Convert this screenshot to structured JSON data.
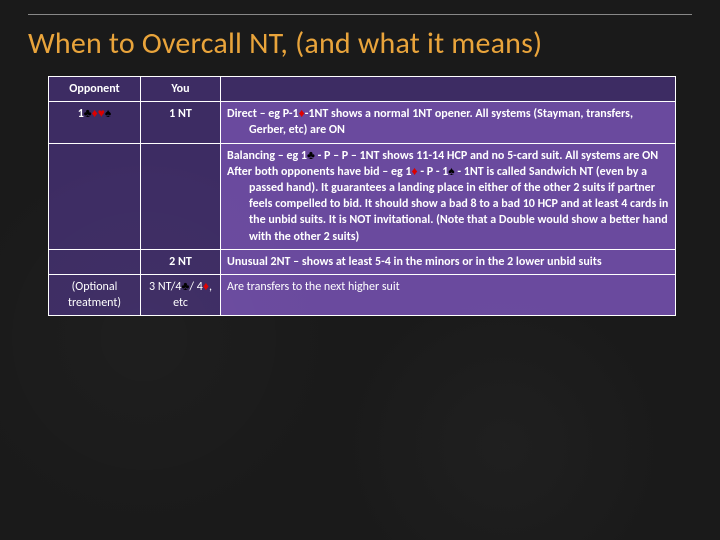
{
  "title": "When to Overcall NT, (and what it means)",
  "suits": {
    "club": "♣",
    "diamond": "♦",
    "heart": "♥",
    "spade": "♠"
  },
  "headers": {
    "opponent": "Opponent",
    "you": "You"
  },
  "rows": [
    {
      "opponent_prefix": "1",
      "opponent_suits": [
        "club",
        "diamond",
        "heart",
        "spade"
      ],
      "you": "1 NT",
      "desc_lead": "Direct – eg P-1",
      "desc_mid_suit": "diamond",
      "desc_tail": "-1NT shows a normal 1NT opener. All systems (Stayman, transfers, Gerber, etc) are ON"
    },
    {
      "opponent_prefix": "",
      "you": "",
      "para1_lead": "Balancing – eg 1",
      "para1_suit": "club",
      "para1_tail": " - P – P – 1NT shows 11-14 HCP and no 5-card suit. All systems are ON",
      "para2_lead": "After both opponents have bid – eg  1",
      "para2_suit1": "diamond",
      "para2_mid": " - P - 1",
      "para2_suit2": "spade",
      "para2_tail": " - 1NT is called Sandwich NT (even by a passed hand). It guarantees a landing place in either of the other 2 suits if partner feels compelled to bid. It should show a bad 8 to a bad 10 HCP and at least 4 cards in the unbid suits. It is NOT invitational. (Note that a Double would show a better hand with the other 2 suits)"
    },
    {
      "opponent_prefix": "",
      "you": "2 NT",
      "desc": "Unusual 2NT – shows at least 5-4 in the minors or in the 2 lower unbid suits"
    },
    {
      "opponent_line1": "(Optional",
      "opponent_line2": "treatment)",
      "you_p1": "3 NT/4",
      "you_s1": "club",
      "you_p2": "/ 4",
      "you_s2": "diamond",
      "you_p3": ", etc",
      "desc": "Are transfers to the next higher suit"
    }
  ]
}
